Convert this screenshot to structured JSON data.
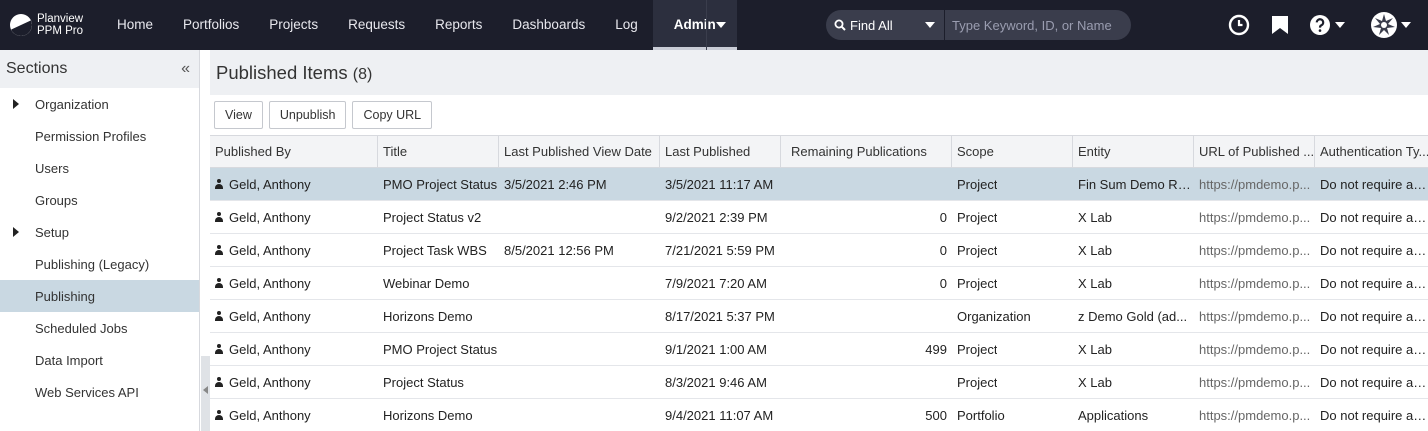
{
  "app": {
    "brand_line1": "Planview",
    "brand_line2": "PPM Pro"
  },
  "nav": {
    "items": [
      "Home",
      "Portfolios",
      "Projects",
      "Requests",
      "Reports",
      "Dashboards",
      "Log",
      "Admin"
    ],
    "active": "Admin"
  },
  "search": {
    "type": "Find All",
    "placeholder": "Type Keyword, ID, or Name"
  },
  "icons": {
    "clock": "clock-icon",
    "bookmark": "bookmark-icon",
    "help": "help-icon",
    "avatar": "avatar-icon"
  },
  "sidebar": {
    "title": "Sections",
    "items": [
      {
        "label": "Organization",
        "expandable": true
      },
      {
        "label": "Permission Profiles",
        "expandable": false
      },
      {
        "label": "Users",
        "expandable": false
      },
      {
        "label": "Groups",
        "expandable": false
      },
      {
        "label": "Setup",
        "expandable": true
      },
      {
        "label": "Publishing (Legacy)",
        "expandable": false
      },
      {
        "label": "Publishing",
        "expandable": false,
        "active": true
      },
      {
        "label": "Scheduled Jobs",
        "expandable": false
      },
      {
        "label": "Data Import",
        "expandable": false
      },
      {
        "label": "Web Services API",
        "expandable": false
      }
    ]
  },
  "page": {
    "title": "Published Items",
    "count": "(8)"
  },
  "toolbar": {
    "view": "View",
    "unpublish": "Unpublish",
    "copy_url": "Copy URL"
  },
  "table": {
    "columns": [
      "Published By",
      "Title",
      "Last Published View Date",
      "Last Published",
      "Remaining Publications",
      "Scope",
      "Entity",
      "URL of Published ...",
      "Authentication Ty..."
    ],
    "rows": [
      [
        "Geld, Anthony",
        "PMO Project Status",
        "3/5/2021 2:46 PM",
        "3/5/2021 11:17 AM",
        "",
        "Project",
        "Fin Sum Demo Re...",
        "https://pmdemo.p...",
        "Do not require an..."
      ],
      [
        "Geld, Anthony",
        "Project Status v2",
        "",
        "9/2/2021 2:39 PM",
        "0",
        "Project",
        "X Lab",
        "https://pmdemo.p...",
        "Do not require an..."
      ],
      [
        "Geld, Anthony",
        "Project Task WBS",
        "8/5/2021 12:56 PM",
        "7/21/2021 5:59 PM",
        "0",
        "Project",
        "X Lab",
        "https://pmdemo.p...",
        "Do not require an..."
      ],
      [
        "Geld, Anthony",
        "Webinar Demo",
        "",
        "7/9/2021 7:20 AM",
        "0",
        "Project",
        "X Lab",
        "https://pmdemo.p...",
        "Do not require an..."
      ],
      [
        "Geld, Anthony",
        "Horizons Demo",
        "",
        "8/17/2021 5:37 PM",
        "",
        "Organization",
        "z Demo Gold (ad...",
        "https://pmdemo.p...",
        "Do not require an..."
      ],
      [
        "Geld, Anthony",
        "PMO Project Status",
        "",
        "9/1/2021 1:00 AM",
        "499",
        "Project",
        "X Lab",
        "https://pmdemo.p...",
        "Do not require an..."
      ],
      [
        "Geld, Anthony",
        "Project Status",
        "",
        "8/3/2021 9:46 AM",
        "",
        "Project",
        "X Lab",
        "https://pmdemo.p...",
        "Do not require an..."
      ],
      [
        "Geld, Anthony",
        "Horizons Demo",
        "",
        "9/4/2021 11:07 AM",
        "500",
        "Portfolio",
        "Applications",
        "https://pmdemo.p...",
        "Do not require an..."
      ]
    ],
    "selected_row": 0
  },
  "colors": {
    "topbar": "#1c1e2b",
    "selected": "#c9d8e2",
    "panel": "#eef0f3"
  }
}
